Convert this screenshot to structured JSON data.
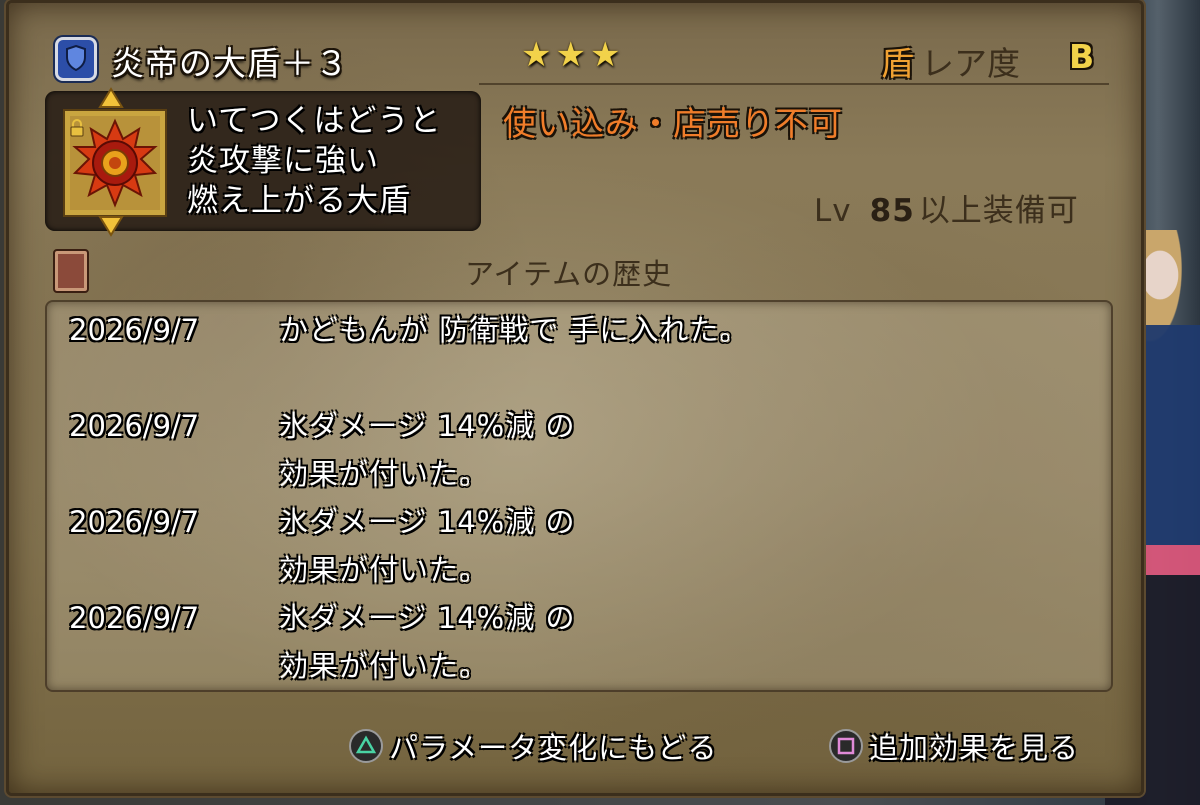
{
  "item": {
    "name": "炎帝の大盾＋３",
    "stars": "★★★",
    "rarity_kind": "盾",
    "rarity_label": "レア度",
    "rarity_grade": "B",
    "description": [
      "いてつくはどうと",
      "炎攻撃に強い",
      "燃え上がる大盾"
    ],
    "restriction": "使い込み・店売り不可",
    "level_prefix": "Lv",
    "level_value": "85",
    "level_suffix": "以上装備可",
    "category_icon": "shield-icon",
    "item_icon": "flame-sun-shield-icon",
    "locked_icon": "lock-icon"
  },
  "history": {
    "title": "アイテムの歴史",
    "entries": [
      {
        "date": "2026/9/7",
        "text": "かどもんが 防衛戦で 手に入れた。"
      },
      {
        "date": "2026/9/7",
        "text": "氷ダメージ 14%減 の\n効果が付いた。"
      },
      {
        "date": "2026/9/7",
        "text": "氷ダメージ 14%減 の\n効果が付いた。"
      },
      {
        "date": "2026/9/7",
        "text": "氷ダメージ 14%減 の\n効果が付いた。"
      }
    ]
  },
  "footer": {
    "back_label": "パラメータ変化にもどる",
    "back_button_icon": "triangle-button-icon",
    "extra_label": "追加効果を見る",
    "extra_button_icon": "square-button-icon"
  },
  "colors": {
    "parchment": "#857552",
    "text_outline": "#000000",
    "restriction": "#f07d2a",
    "star": "#f2d24a",
    "rarity_kind": "#f0a132"
  }
}
